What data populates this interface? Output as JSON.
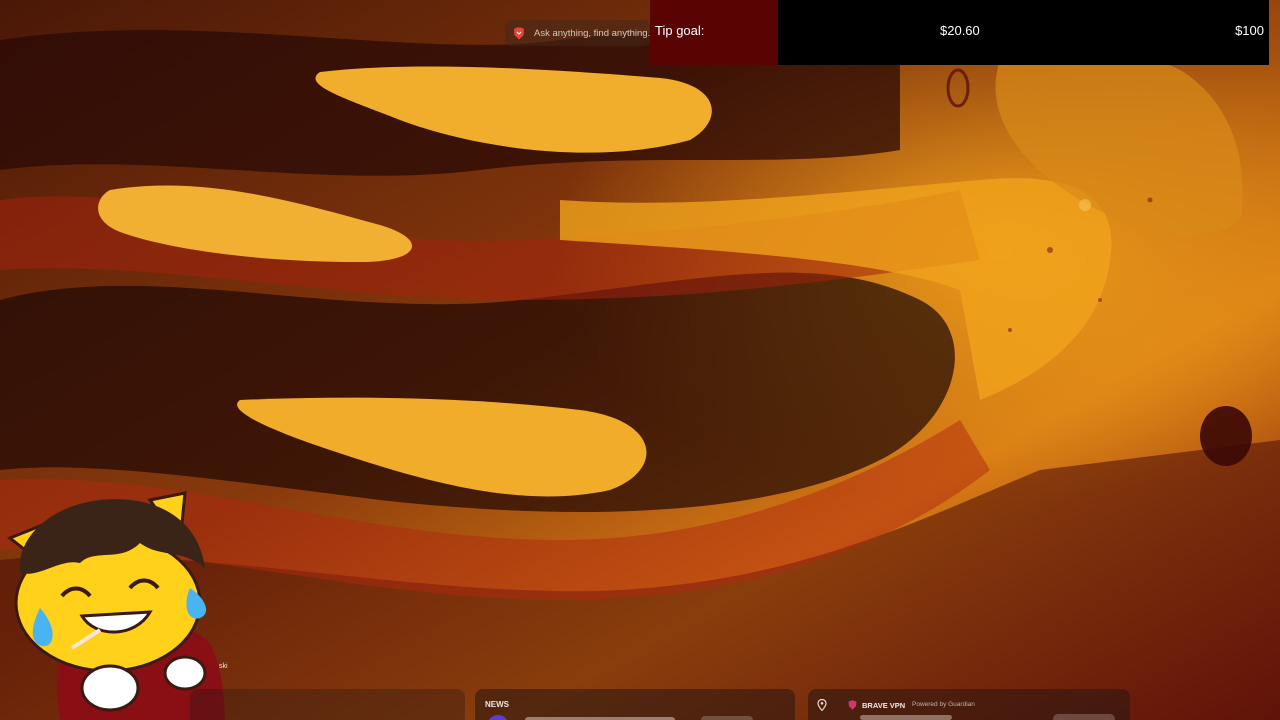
{
  "search": {
    "placeholder": "Ask anything, find anything..."
  },
  "tip_goal": {
    "label": "Tip goal:",
    "current": "$20.60",
    "goal": "$100",
    "progress_fraction": 0.206,
    "fill_color": "#5a0303",
    "bar_color": "#000000"
  },
  "mascot": {
    "caption": "ski"
  },
  "widgets": {
    "news": {
      "title": "NEWS"
    },
    "vpn": {
      "title": "BRAVE VPN",
      "powered_by": "Powered by Guardian"
    }
  },
  "icons": {
    "search": "brave-lion-icon",
    "vpn_location": "location-pin-icon",
    "vpn_brand": "brave-shield-icon"
  },
  "colors": {
    "wallpaper_dark": "#3a0f06",
    "wallpaper_light": "#f0a21c",
    "mascot_yellow": "#ffd11a",
    "mascot_hoodie": "#8a0f14"
  }
}
